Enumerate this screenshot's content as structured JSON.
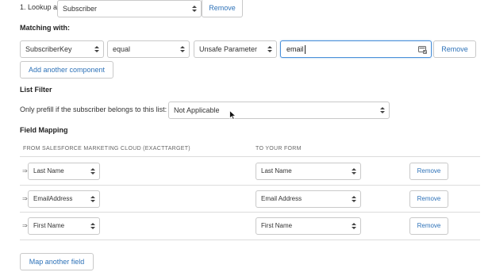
{
  "lookup": {
    "label": "1. Lookup a",
    "object_value": "Subscriber",
    "remove_label": "Remove"
  },
  "matching": {
    "heading": "Matching with:",
    "field_value": "SubscriberKey",
    "operator_value": "equal",
    "type_value": "Unsafe Parameter",
    "param_value": "email",
    "remove_label": "Remove",
    "add_component_label": "Add another component"
  },
  "list_filter": {
    "heading": "List Filter",
    "label": "Only prefill if the subscriber belongs to this list:",
    "value": "Not Applicable"
  },
  "field_mapping": {
    "heading": "Field Mapping",
    "col_from": "FROM SALESFORCE MARKETING CLOUD (EXACTTARGET)",
    "col_to": "TO YOUR FORM",
    "rows": [
      {
        "from": "Last Name",
        "to": "Last Name",
        "remove": "Remove"
      },
      {
        "from": "EmailAddress",
        "to": "Email Address",
        "remove": "Remove"
      },
      {
        "from": "First Name",
        "to": "First Name",
        "remove": "Remove"
      }
    ],
    "drag_glyph": "⇒",
    "map_another_label": "Map another field"
  },
  "colors": {
    "link_blue": "#2e72b8",
    "focus_blue": "#4a90d9",
    "border": "#c9c9c9"
  }
}
